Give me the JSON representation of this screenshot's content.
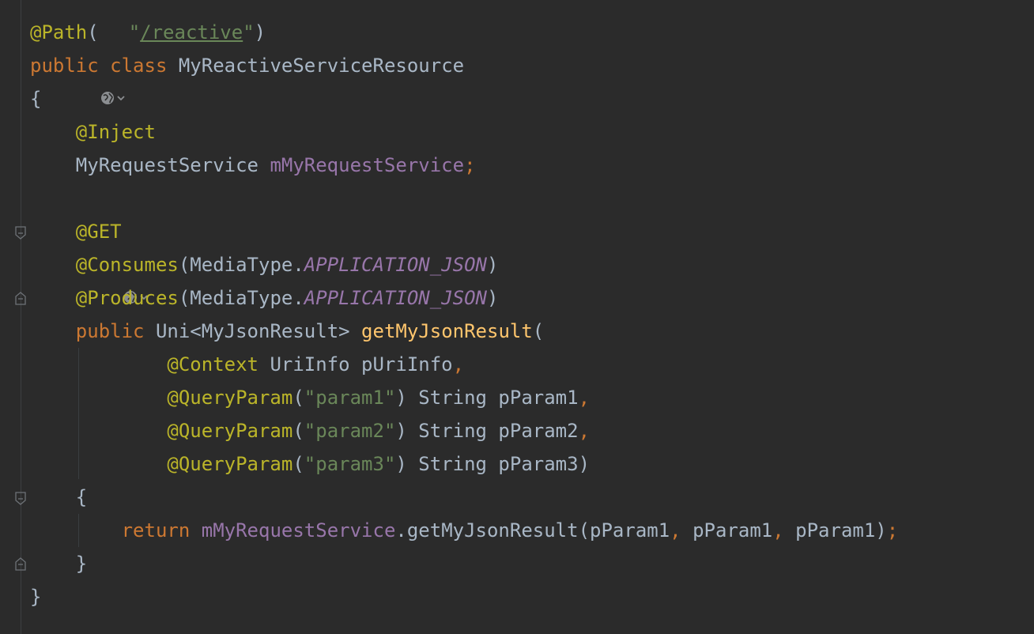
{
  "editor": {
    "lines": [
      {
        "segments": [
          {
            "t": "@Path",
            "c": "ann"
          },
          {
            "t": "(",
            "c": "plain"
          },
          {
            "icon": "globe-icon"
          },
          {
            "t": "\"",
            "c": "str"
          },
          {
            "t": "/reactive",
            "c": "str ul"
          },
          {
            "t": "\"",
            "c": "str"
          },
          {
            "t": ")",
            "c": "plain"
          }
        ]
      },
      {
        "segments": [
          {
            "t": "public ",
            "c": "kw"
          },
          {
            "t": "class ",
            "c": "kw"
          },
          {
            "t": "MyReactiveServiceResource",
            "c": "plain"
          }
        ]
      },
      {
        "segments": [
          {
            "t": "{",
            "c": "plain"
          }
        ]
      },
      {
        "segments": [
          {
            "t": "    "
          },
          {
            "t": "@Inject",
            "c": "ann"
          }
        ]
      },
      {
        "segments": [
          {
            "t": "    "
          },
          {
            "t": "MyRequestService ",
            "c": "plain"
          },
          {
            "t": "mMyRequestService",
            "c": "fld"
          },
          {
            "t": ";",
            "c": "punc"
          }
        ]
      },
      {
        "segments": []
      },
      {
        "segments": [
          {
            "t": "    "
          },
          {
            "t": "@GET",
            "c": "ann"
          },
          {
            "icon": "globe-icon"
          }
        ]
      },
      {
        "segments": [
          {
            "t": "    "
          },
          {
            "t": "@Consumes",
            "c": "ann"
          },
          {
            "t": "(MediaType.",
            "c": "plain"
          },
          {
            "t": "APPLICATION_JSON",
            "c": "cst"
          },
          {
            "t": ")",
            "c": "plain"
          }
        ]
      },
      {
        "segments": [
          {
            "t": "    "
          },
          {
            "t": "@Produces",
            "c": "ann"
          },
          {
            "t": "(MediaType.",
            "c": "plain"
          },
          {
            "t": "APPLICATION_JSON",
            "c": "cst"
          },
          {
            "t": ")",
            "c": "plain"
          }
        ]
      },
      {
        "segments": [
          {
            "t": "    "
          },
          {
            "t": "public ",
            "c": "kw"
          },
          {
            "t": "Uni<MyJsonResult> ",
            "c": "plain"
          },
          {
            "t": "getMyJsonResult",
            "c": "fn"
          },
          {
            "t": "(",
            "c": "plain"
          }
        ]
      },
      {
        "segments": [
          {
            "t": "            "
          },
          {
            "t": "@Context ",
            "c": "ann"
          },
          {
            "t": "UriInfo pUriInfo",
            "c": "plain"
          },
          {
            "t": ",",
            "c": "punc"
          }
        ]
      },
      {
        "segments": [
          {
            "t": "            "
          },
          {
            "t": "@QueryParam",
            "c": "ann"
          },
          {
            "t": "(",
            "c": "plain"
          },
          {
            "t": "\"param1\"",
            "c": "str"
          },
          {
            "t": ") String pParam1",
            "c": "plain"
          },
          {
            "t": ",",
            "c": "punc"
          }
        ]
      },
      {
        "segments": [
          {
            "t": "            "
          },
          {
            "t": "@QueryParam",
            "c": "ann"
          },
          {
            "t": "(",
            "c": "plain"
          },
          {
            "t": "\"param2\"",
            "c": "str"
          },
          {
            "t": ") String pParam2",
            "c": "plain"
          },
          {
            "t": ",",
            "c": "punc"
          }
        ]
      },
      {
        "segments": [
          {
            "t": "            "
          },
          {
            "t": "@QueryParam",
            "c": "ann"
          },
          {
            "t": "(",
            "c": "plain"
          },
          {
            "t": "\"param3\"",
            "c": "str"
          },
          {
            "t": ") String pParam3)",
            "c": "plain"
          }
        ]
      },
      {
        "segments": [
          {
            "t": "    "
          },
          {
            "t": "{",
            "c": "plain"
          }
        ]
      },
      {
        "segments": [
          {
            "t": "        "
          },
          {
            "t": "return ",
            "c": "kw"
          },
          {
            "t": "mMyRequestService",
            "c": "fld"
          },
          {
            "t": ".getMyJsonResult(pParam1",
            "c": "plain"
          },
          {
            "t": ", ",
            "c": "punc"
          },
          {
            "t": "pParam1",
            "c": "plain"
          },
          {
            "t": ", ",
            "c": "punc"
          },
          {
            "t": "pParam1)",
            "c": "plain"
          },
          {
            "t": ";",
            "c": "punc"
          }
        ]
      },
      {
        "segments": [
          {
            "t": "    "
          },
          {
            "t": "}",
            "c": "plain"
          }
        ]
      },
      {
        "segments": [
          {
            "t": "}",
            "c": "plain"
          }
        ]
      }
    ]
  },
  "colors": {
    "background": "#2b2b2b",
    "annotation": "#bbb529",
    "keyword": "#cc7832",
    "string": "#6a8759",
    "field": "#9876aa",
    "method": "#ffc66d",
    "text": "#a9b7c6"
  },
  "icons": {
    "globe": "globe-icon",
    "fold_open": "fold-open-icon",
    "fold_close": "fold-close-icon"
  }
}
